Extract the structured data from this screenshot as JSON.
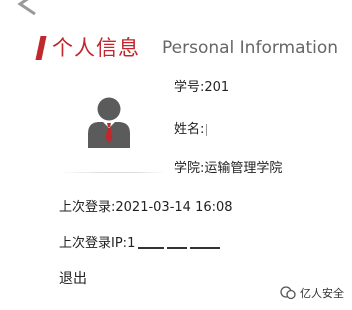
{
  "header": {
    "title_cn": "个人信息",
    "title_en": "Personal Information",
    "accent_color": "#c0282d",
    "back_icon": "chevron-left-icon"
  },
  "profile": {
    "avatar_icon": "user-avatar-icon",
    "student_id_label": "学号:",
    "student_id_value": "201",
    "name_label": "姓名:",
    "name_value": "",
    "college_label": "学院:",
    "college_value": "运输管理学院"
  },
  "login": {
    "last_login_label": "上次登录:",
    "last_login_value": "2021-03-14 16:08",
    "last_ip_label": "上次登录IP:",
    "last_ip_value": "1"
  },
  "actions": {
    "logout_label": "退出"
  },
  "watermark": {
    "icon": "wechat-channel-icon",
    "text": "亿人安全"
  }
}
